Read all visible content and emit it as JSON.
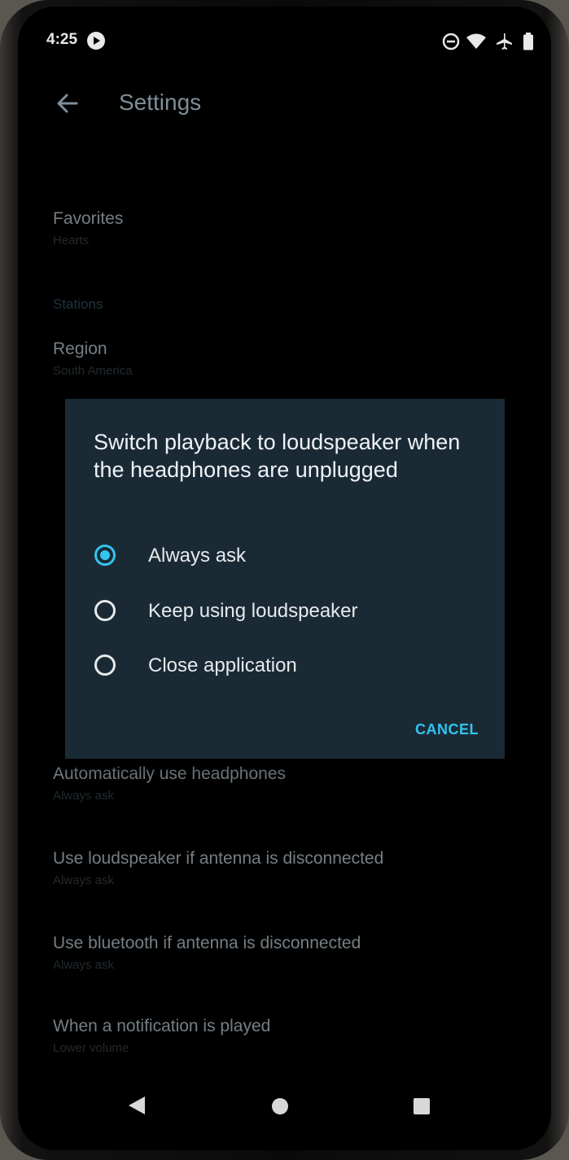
{
  "status_bar": {
    "time": "4:25",
    "icons": [
      "media-app-icon",
      "do-not-disturb-icon",
      "wifi-icon",
      "airplane-mode-icon",
      "battery-icon"
    ]
  },
  "app_bar": {
    "title": "Settings"
  },
  "settings": {
    "favorites": {
      "title": "Favorites",
      "summary": "Hearts"
    },
    "stations_category": "Stations",
    "region": {
      "title": "Region",
      "summary": "South America"
    },
    "auto_headphones": {
      "title": "Automatically use headphones",
      "summary": "Always ask"
    },
    "loudspeaker_antenna": {
      "title": "Use loudspeaker if antenna is disconnected",
      "summary": "Always ask"
    },
    "bluetooth_antenna": {
      "title": "Use bluetooth if antenna is disconnected",
      "summary": "Always ask"
    },
    "notification": {
      "title": "When a notification is played",
      "summary": "Lower volume"
    }
  },
  "dialog": {
    "title": "Switch playback to loudspeaker when the headphones are unplugged",
    "options": [
      {
        "label": "Always ask",
        "selected": true
      },
      {
        "label": "Keep using loudspeaker",
        "selected": false
      },
      {
        "label": "Close application",
        "selected": false
      }
    ],
    "cancel_label": "CANCEL"
  },
  "colors": {
    "accent": "#33c4f0",
    "dialog_bg": "#1a2a35",
    "screen_bg": "#000000"
  }
}
